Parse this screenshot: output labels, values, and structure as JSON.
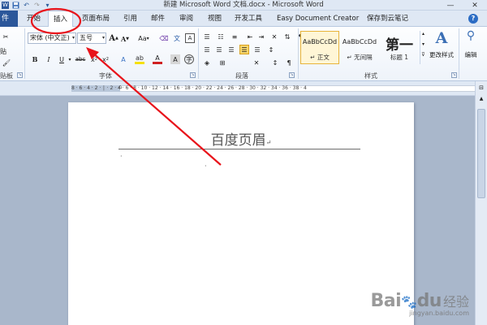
{
  "window": {
    "title": "新建 Microsoft Word 文档.docx - Microsoft Word",
    "minimize": "—",
    "close": "✕"
  },
  "qat": {
    "save_icon": "save-icon",
    "undo_icon": "undo-icon",
    "redo_icon": "redo-icon",
    "more": "▾"
  },
  "tabs": {
    "file": "件",
    "items": [
      "开始",
      "插入",
      "页面布局",
      "引用",
      "邮件",
      "审阅",
      "视图",
      "开发工具",
      "Easy Document Creator",
      "保存到云笔记"
    ],
    "active": "插入"
  },
  "ribbon": {
    "clipboard_label": "贴板",
    "paste_label": "贴",
    "font": {
      "label": "字体",
      "font_name": "宋体 (中文正)",
      "font_size": "五号",
      "grow": "A",
      "shrink": "A",
      "case": "Aa",
      "bold": "B",
      "italic": "I",
      "underline": "U",
      "strike": "abc",
      "subscript": "x",
      "superscript": "x"
    },
    "paragraph": {
      "label": "段落"
    },
    "styles": {
      "label": "样式",
      "items": [
        {
          "sample": "AaBbCcDd",
          "name": "↵ 正文"
        },
        {
          "sample": "AaBbCcDd",
          "name": "↵ 无间隔"
        },
        {
          "sample": "第一",
          "name": "标题 1"
        }
      ],
      "change_styles": "更改样式"
    },
    "editing": {
      "label": "编辑"
    }
  },
  "ruler": {
    "numbers": "8 · 6 · 4 · 2 · │ · 2 · 4 · 6 · 8 · 10 · 12 · 14 · 16 · 18 · 20 · 22 · 24 · 26 · 28 · 30 · 32 · 34 · 36 · 38 · 4"
  },
  "document": {
    "header_text": "百度页眉",
    "header_mark": "↵",
    "body_mark": "·"
  },
  "watermark": {
    "brand": "Bai",
    "paw": "🐾",
    "brand2": "du",
    "cn": "经验",
    "url": "jingyan.baidu.com"
  },
  "colors": {
    "file_tab": "#2b579a",
    "annotation": "#e8141b",
    "selected_style": "#e8b43a"
  }
}
